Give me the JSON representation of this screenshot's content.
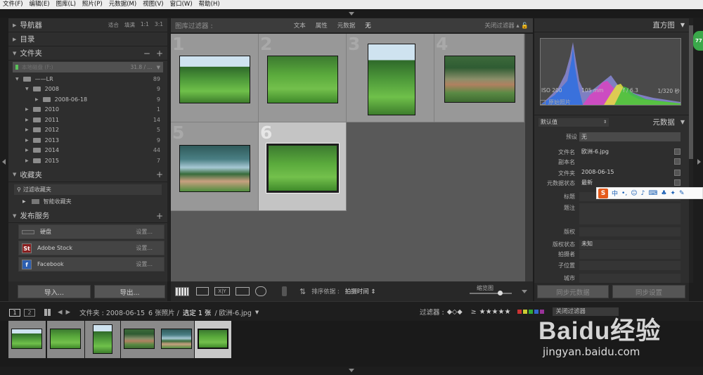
{
  "menu": [
    "文件(F)",
    "编辑(E)",
    "图库(L)",
    "照片(P)",
    "元数据(M)",
    "视图(V)",
    "窗口(W)",
    "帮助(H)"
  ],
  "left": {
    "navigator": {
      "title": "导航器",
      "zoom": [
        "适合",
        "填满",
        "1:1",
        "3:1"
      ]
    },
    "catalog": {
      "title": "目录"
    },
    "folders": {
      "title": "文件夹",
      "drive": {
        "label": "本地磁盘 (F:)",
        "size": "31.8 / ..."
      },
      "items": [
        {
          "label": "——LR",
          "count": "89",
          "depth": 0
        },
        {
          "label": "2008",
          "count": "9",
          "depth": 1
        },
        {
          "label": "2008-06-18",
          "count": "9",
          "depth": 2
        },
        {
          "label": "2010",
          "count": "1",
          "depth": 1
        },
        {
          "label": "2011",
          "count": "14",
          "depth": 1
        },
        {
          "label": "2012",
          "count": "5",
          "depth": 1
        },
        {
          "label": "2013",
          "count": "9",
          "depth": 1
        },
        {
          "label": "2014",
          "count": "44",
          "depth": 1
        },
        {
          "label": "2015",
          "count": "7",
          "depth": 1
        }
      ]
    },
    "collections": {
      "title": "收藏夹",
      "filter_label": "过滤收藏夹",
      "smart": "智能收藏夹"
    },
    "publish": {
      "title": "发布服务",
      "services": [
        {
          "label": "硬盘",
          "setting": "设置..."
        },
        {
          "label": "Adobe Stock",
          "setting": "设置..."
        },
        {
          "label": "Facebook",
          "setting": "设置..."
        }
      ]
    },
    "import_btn": "导入...",
    "export_btn": "导出..."
  },
  "filterbar": {
    "title": "图库过滤器 :",
    "tabs": [
      "文本",
      "属性",
      "元数据",
      "无"
    ],
    "close": "关闭过滤器"
  },
  "grid": {
    "numbers": [
      "1",
      "2",
      "3",
      "4",
      "5",
      "6"
    ]
  },
  "toolbar": {
    "sort_label": "排序依据 :",
    "sort_value": "拍摄时间",
    "thumb_label": "缩览图"
  },
  "right": {
    "histogram": {
      "title": "直方图",
      "iso": "ISO 200",
      "focal": "105 mm",
      "aperture": "f / 6.3",
      "shutter": "1/320 秒",
      "original": "原始照片"
    },
    "metadata": {
      "preset_name": "默认值",
      "title": "元数据",
      "preset_label": "预设",
      "preset_value": "无",
      "fields": [
        {
          "label": "文件名",
          "value": "欧洲-6.jpg"
        },
        {
          "label": "副本名",
          "value": ""
        },
        {
          "label": "文件夹",
          "value": "2008-06-15"
        },
        {
          "label": "元数据状态",
          "value": "最新"
        },
        {
          "label": "标题",
          "value": ""
        },
        {
          "label": "题注",
          "value": ""
        },
        {
          "label": "版权",
          "value": ""
        },
        {
          "label": "版权状态",
          "value": "未知"
        },
        {
          "label": "拍摄者",
          "value": ""
        },
        {
          "label": "子位置",
          "value": ""
        },
        {
          "label": "城市",
          "value": ""
        }
      ]
    },
    "sync_meta": "同步元数据",
    "sync_settings": "同步设置"
  },
  "filmstrip_bar": {
    "page1": "1",
    "page2": "2",
    "path": "文件夹 : 2008-06-15",
    "count": "6 张照片 /",
    "selected": "选定 1 张",
    "file": "/ 欧洲-6.jpg",
    "filter_label": "过滤器 :",
    "filter_close": "关闭过滤器"
  },
  "ime": {
    "logo": "S",
    "lang": "中"
  },
  "watermark": {
    "brand": "Baidu经验",
    "url": "jingyan.baidu.com"
  },
  "badge": "77"
}
